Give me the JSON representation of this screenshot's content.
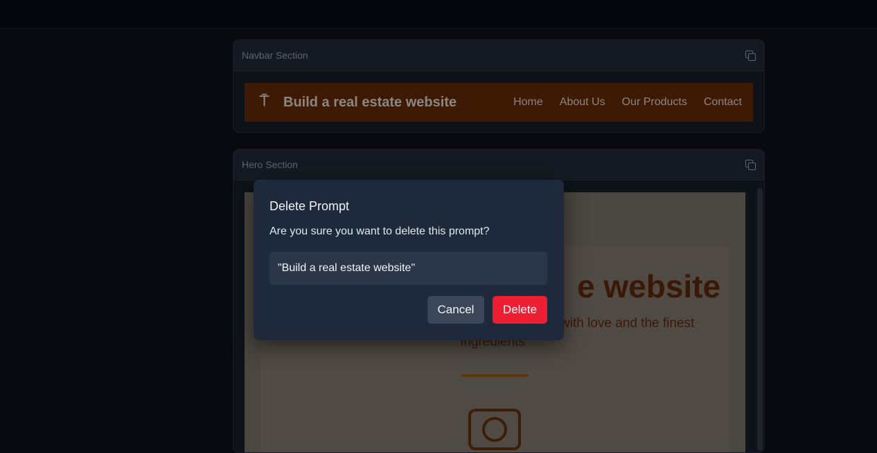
{
  "navbar_panel": {
    "title": "Navbar Section"
  },
  "navbar_preview": {
    "logo_glyph": "⍑",
    "brand": "Build a real estate website",
    "links": [
      "Home",
      "About Us",
      "Our Products",
      "Contact"
    ]
  },
  "hero_panel": {
    "title": "Hero Section"
  },
  "hero_preview": {
    "title_visible": "e website",
    "subtitle_visible": "with love and the finest",
    "subtitle_line2": "ingredients"
  },
  "dialog": {
    "title": "Delete Prompt",
    "message": "Are you sure you want to delete this prompt?",
    "prompt_quote": "\"Build a real estate website\"",
    "cancel_label": "Cancel",
    "delete_label": "Delete"
  },
  "colors": {
    "delete_button": "#ef1f33",
    "dialog_bg": "#1e293b",
    "navbar_preview_bg": "#3e1904"
  },
  "icons": [
    "copy-icon",
    "logo-icon",
    "camera-icon"
  ]
}
